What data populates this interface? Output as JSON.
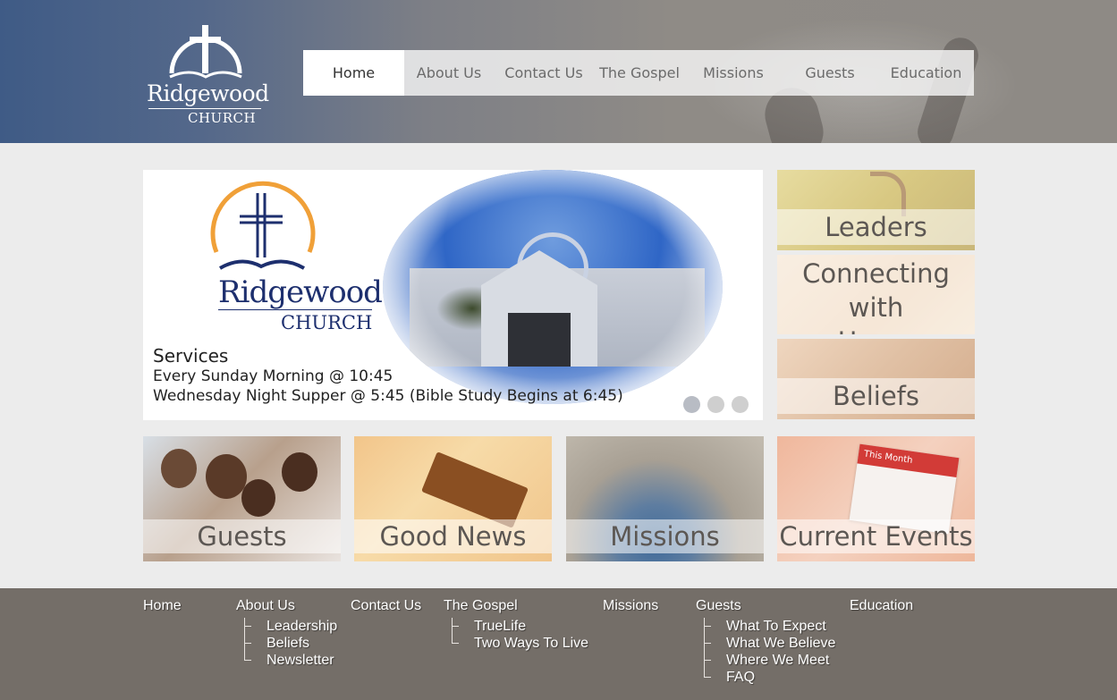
{
  "header": {
    "logo": {
      "name": "Ridgewood",
      "church": "CHURCH"
    },
    "nav": [
      {
        "label": "Home",
        "active": true
      },
      {
        "label": "About Us",
        "active": false
      },
      {
        "label": "Contact Us",
        "active": false
      },
      {
        "label": "The Gospel",
        "active": false
      },
      {
        "label": "Missions",
        "active": false
      },
      {
        "label": "Guests",
        "active": false
      },
      {
        "label": "Education",
        "active": false
      }
    ]
  },
  "slider": {
    "logo": {
      "name": "Ridgewood",
      "church": "CHURCH"
    },
    "title": "Services",
    "lines": [
      "Every Sunday Morning @ 10:45",
      "Wednesday Night Supper @ 5:45 (Bible Study Begins at 6:45)"
    ],
    "dots": 3,
    "active_dot": 0,
    "photo_sign": "Ridgewood CHURCH"
  },
  "tiles": {
    "leaders": "Leaders",
    "connecting": [
      "Connecting with",
      "Home"
    ],
    "beliefs": "Beliefs",
    "guests": "Guests",
    "good_news": "Good News",
    "missions": "Missions",
    "current_events": "Current Events",
    "calendar_header": "This Month"
  },
  "footer": {
    "columns": [
      {
        "label": "Home",
        "children": []
      },
      {
        "label": "About Us",
        "children": [
          "Leadership",
          "Beliefs",
          "Newsletter"
        ]
      },
      {
        "label": "Contact Us",
        "children": []
      },
      {
        "label": "The Gospel",
        "children": [
          "TrueLife",
          "Two Ways To Live"
        ]
      },
      {
        "label": "Missions",
        "children": []
      },
      {
        "label": "Guests",
        "children": [
          "What To Expect",
          "What We Believe",
          "Where We Meet",
          "FAQ"
        ]
      },
      {
        "label": "Education",
        "children": []
      }
    ]
  },
  "colors": {
    "header_blue": "#3f5b86",
    "header_gray": "#8e8a85",
    "footer": "#746e68",
    "logo_navy": "#1d2f6e",
    "logo_orange": "#f0a038"
  }
}
